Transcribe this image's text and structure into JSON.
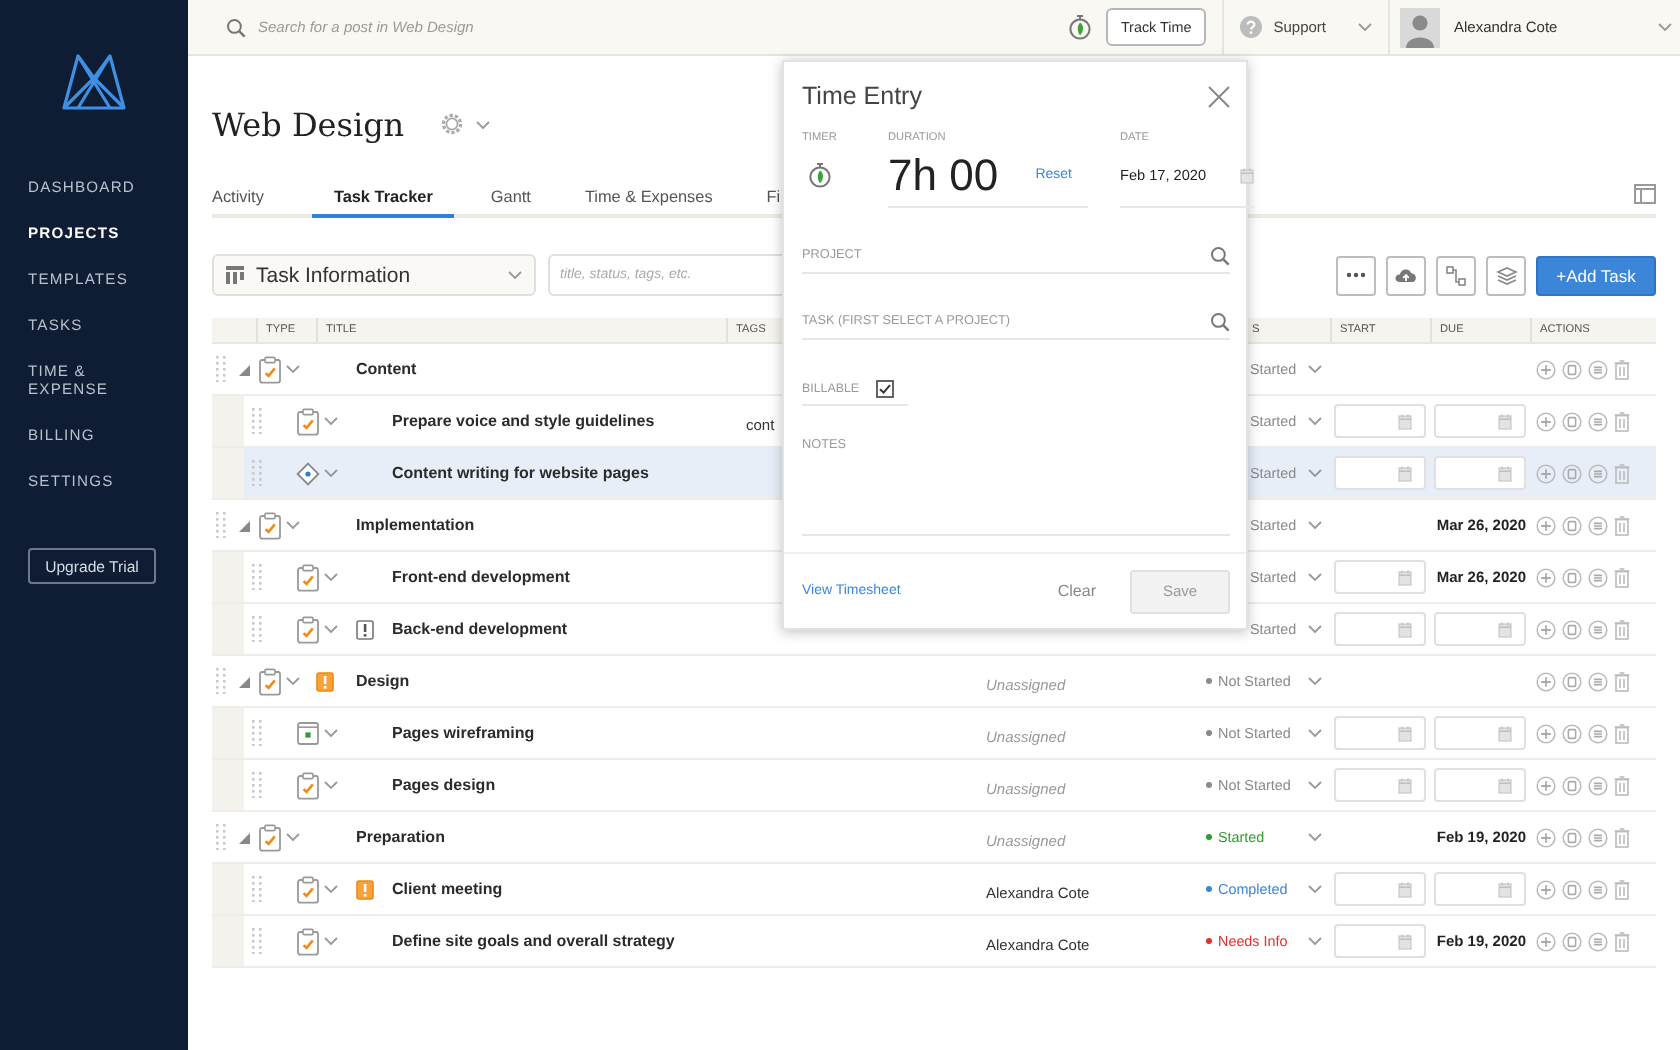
{
  "sidebar": {
    "nav": [
      {
        "label": "DASHBOARD",
        "selected": false
      },
      {
        "label": "PROJECTS",
        "selected": true
      },
      {
        "label": "TEMPLATES",
        "selected": false
      },
      {
        "label": "TASKS",
        "selected": false
      },
      {
        "label": "TIME & EXPENSE",
        "selected": false
      },
      {
        "label": "BILLING",
        "selected": false
      },
      {
        "label": "SETTINGS",
        "selected": false
      }
    ],
    "upgrade_button": "Upgrade Trial"
  },
  "topbar": {
    "search": {
      "placeholder": "Search for a post in Web Design"
    },
    "track_time_button": "Track Time",
    "support": "Support",
    "user": "Alexandra Cote"
  },
  "project": {
    "title": "Web Design"
  },
  "tabs": [
    {
      "label": "Activity",
      "selected": false
    },
    {
      "label": "Task Tracker",
      "selected": true
    },
    {
      "label": "Gantt",
      "selected": false
    },
    {
      "label": "Time & Expenses",
      "selected": false
    },
    {
      "label": "Fi",
      "selected": false
    }
  ],
  "toolbar": {
    "view_select": "Task Information",
    "filter": {
      "placeholder": "title, status, tags, etc."
    },
    "add_button": "+Add Task"
  },
  "table": {
    "columns": [
      "TYPE",
      "TITLE",
      "TAGS",
      "S",
      "START",
      "DUE",
      "ACTIONS"
    ],
    "rows": [
      {
        "title": "Content",
        "kind": "task",
        "expanded": true,
        "selected": false,
        "status": {
          "text": "Started"
        },
        "children": [
          {
            "title": "Prepare voice and style guidelines",
            "kind": "task",
            "selected": false,
            "tags": "cont",
            "status": {
              "text": "Started"
            },
            "start": {
              "kind": "input"
            },
            "due": {
              "kind": "input"
            }
          },
          {
            "title": "Content writing for website pages",
            "kind": "milestone",
            "selected": true,
            "status": {
              "text": "Started"
            },
            "start": {
              "kind": "input"
            },
            "due": {
              "kind": "input"
            }
          }
        ]
      },
      {
        "title": "Implementation",
        "kind": "task",
        "expanded": true,
        "selected": false,
        "status": {
          "text": "Started"
        },
        "due": {
          "kind": "text",
          "text": "Mar 26, 2020"
        },
        "children": [
          {
            "title": "Front-end development",
            "kind": "task",
            "selected": false,
            "status": {
              "text": "Started"
            },
            "start": {
              "kind": "input"
            },
            "due": {
              "kind": "text",
              "text": "Mar 26, 2020"
            }
          },
          {
            "title": "Back-end development",
            "kind": "task",
            "priority": {
              "kind": "normal"
            },
            "selected": false,
            "status": {
              "text": "Started"
            },
            "start": {
              "kind": "input"
            },
            "due": {
              "kind": "input"
            }
          }
        ]
      },
      {
        "title": "Design",
        "kind": "task",
        "priority": {
          "kind": "high"
        },
        "expanded": true,
        "selected": false,
        "assignee": {
          "name": "Unassigned",
          "assigned": false
        },
        "status": {
          "text": "Not Started",
          "color": "#8a8a8a"
        },
        "children": [
          {
            "title": "Pages wireframing",
            "kind": "checkpoint",
            "selected": false,
            "assignee": {
              "name": "Unassigned",
              "assigned": false
            },
            "status": {
              "text": "Not Started",
              "color": "#8a8a8a"
            },
            "start": {
              "kind": "input"
            },
            "due": {
              "kind": "input"
            }
          },
          {
            "title": "Pages design",
            "kind": "task",
            "selected": false,
            "assignee": {
              "name": "Unassigned",
              "assigned": false
            },
            "status": {
              "text": "Not Started",
              "color": "#8a8a8a"
            },
            "start": {
              "kind": "input"
            },
            "due": {
              "kind": "input"
            }
          }
        ]
      },
      {
        "title": "Preparation",
        "kind": "task",
        "expanded": true,
        "selected": false,
        "assignee": {
          "name": "Unassigned",
          "assigned": false
        },
        "status": {
          "text": "Started",
          "color": "#2e9e2e"
        },
        "due": {
          "kind": "text",
          "text": "Feb 19, 2020"
        },
        "children": [
          {
            "title": "Client meeting",
            "kind": "task",
            "priority": {
              "kind": "high"
            },
            "selected": false,
            "assignee": {
              "name": "Alexandra Cote",
              "assigned": true
            },
            "status": {
              "text": "Completed",
              "color": "#3a86d8"
            },
            "start": {
              "kind": "input"
            },
            "due": {
              "kind": "input"
            }
          },
          {
            "title": "Define site goals and overall strategy",
            "kind": "task",
            "selected": false,
            "assignee": {
              "name": "Alexandra Cote",
              "assigned": true
            },
            "status": {
              "text": "Needs Info",
              "color": "#e0302a"
            },
            "start": {
              "kind": "input"
            },
            "due": {
              "kind": "text",
              "text": "Feb 19, 2020"
            }
          }
        ]
      }
    ]
  },
  "time_entry": {
    "title": "Time Entry",
    "timer_label": "TIMER",
    "duration_label": "DURATION",
    "duration": "7h 00",
    "reset_link": "Reset",
    "date_label": "DATE",
    "date": "Feb 17, 2020",
    "project": {
      "placeholder": "PROJECT"
    },
    "task": {
      "placeholder": "TASK (FIRST SELECT A PROJECT)"
    },
    "billable": {
      "label": "BILLABLE",
      "checked": true
    },
    "notes": {
      "placeholder": "NOTES"
    },
    "view_timesheet_link": "View Timesheet",
    "clear_button": "Clear",
    "save_button": {
      "label": "Save",
      "disabled": true
    }
  }
}
